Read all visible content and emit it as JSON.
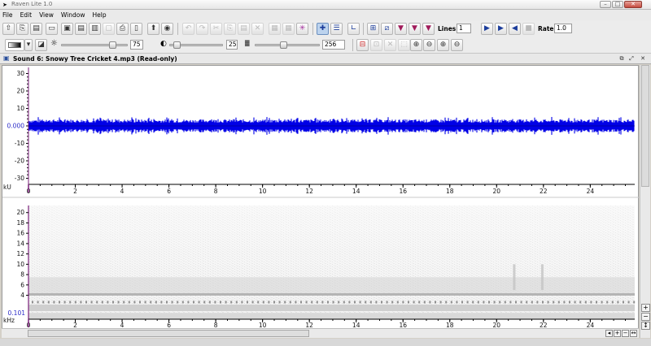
{
  "window": {
    "title": "Raven Lite 1.0"
  },
  "menu": [
    "File",
    "Edit",
    "View",
    "Window",
    "Help"
  ],
  "toolbar": {
    "lines_label": "Lines:",
    "lines_value": "1",
    "rate_label": "Rate:",
    "rate_value": "1.0",
    "brightness_value": "75",
    "contrast_value": "25",
    "window_size_value": "256"
  },
  "document": {
    "title": "Sound 6: Snowy Tree Cricket 4.mp3 (Read-only)"
  },
  "waveform": {
    "unit_label": "kU",
    "y_ticks": [
      "30",
      "20",
      "10",
      "0.000",
      "-10",
      "-20",
      "-30"
    ],
    "x_ticks": [
      "0",
      "2",
      "4",
      "6",
      "8",
      "10",
      "12",
      "14",
      "16",
      "18",
      "20",
      "22",
      "24"
    ],
    "trace_color": "#0000e6"
  },
  "spectrogram": {
    "unit_label": "kHz",
    "y_ticks": [
      "20",
      "18",
      "16",
      "14",
      "12",
      "10",
      "8",
      "6",
      "4"
    ],
    "y_min_label": "0.101",
    "x_ticks": [
      "0",
      "2",
      "4",
      "6",
      "8",
      "10",
      "12",
      "14",
      "16",
      "18",
      "20",
      "22",
      "24"
    ]
  },
  "colors": {
    "selection": "#7a1f7a",
    "accent": "#2b2bc8"
  }
}
